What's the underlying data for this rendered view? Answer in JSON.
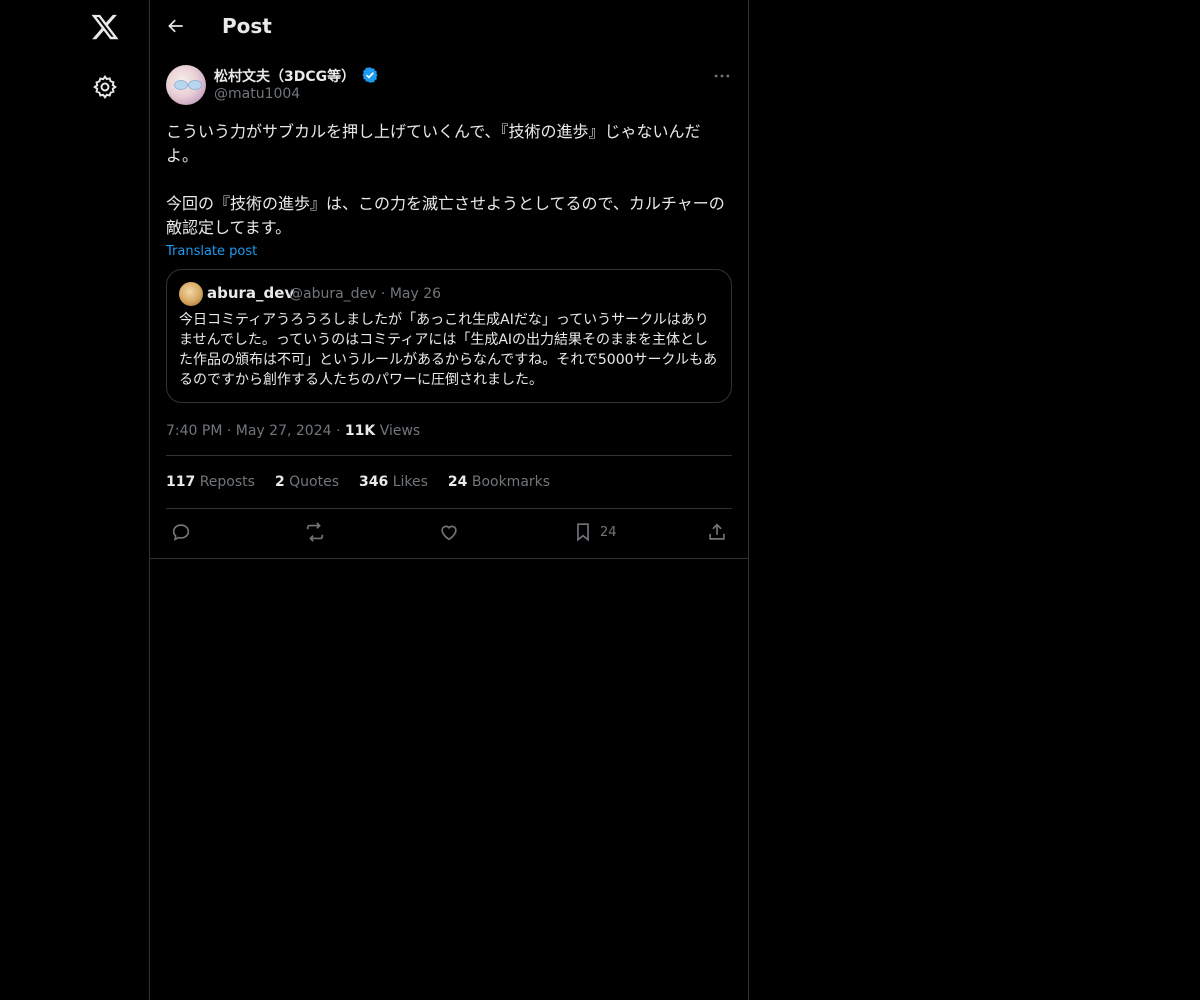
{
  "header": {
    "title": "Post"
  },
  "post": {
    "author": {
      "display_name": "松村文夫（3DCG等）",
      "handle": "@matu1004",
      "verified": true
    },
    "text": "こういう力がサブカルを押し上げていくんで、『技術の進歩』じゃないんだよ。\n\n今回の『技術の進歩』は、この力を滅亡させようとしてるので、カルチャーの敵認定してます。",
    "translate_label": "Translate post",
    "quote": {
      "display_name": "abura_dev",
      "handle": "@abura_dev",
      "date": "May 26",
      "text": "今日コミティアうろうろしましたが「あっこれ生成AIだな」っていうサークルはありませんでした。っていうのはコミティアには「生成AIの出力結果そのままを主体とした作品の頒布は不可」というルールがあるからなんですね。それで5000サークルもあるのですから創作する人たちのパワーに圧倒されました。"
    },
    "time": "7:40 PM",
    "date": "May 27, 2024",
    "views_count": "11K",
    "views_label": "Views",
    "stats": {
      "reposts": {
        "count": "117",
        "label": "Reposts"
      },
      "quotes": {
        "count": "2",
        "label": "Quotes"
      },
      "likes": {
        "count": "346",
        "label": "Likes"
      },
      "bookmarks": {
        "count": "24",
        "label": "Bookmarks"
      }
    },
    "actions": {
      "bookmark_count": "24"
    }
  },
  "colors": {
    "background": "#000000",
    "text": "#e7e9ea",
    "muted": "#71767b",
    "accent": "#1d9bf0",
    "border": "#2f3336"
  },
  "icons": [
    "x-logo-icon",
    "gear-icon",
    "back-arrow-icon",
    "verified-badge-icon",
    "more-icon",
    "reply-icon",
    "repost-icon",
    "like-icon",
    "bookmark-icon",
    "share-icon"
  ]
}
